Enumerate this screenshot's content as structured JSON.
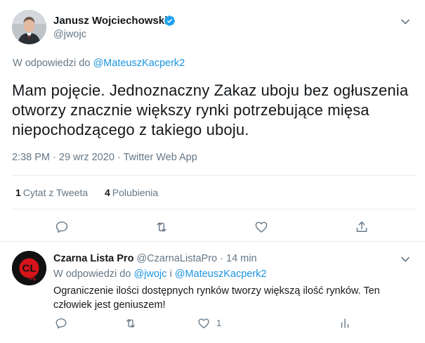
{
  "main_tweet": {
    "author_name": "Janusz Wojciechowski",
    "author_handle": "@jwojc",
    "reply_prefix": "W odpowiedzi do",
    "reply_to": "@MateuszKacperk2",
    "text": "Mam pojęcie. Jednoznaczny Zakaz uboju bez ogłuszenia otworzy znacznie większy rynki potrzebujące mięsa niepochodzącego z takiego uboju.",
    "meta": "2:38 PM · 29 wrz 2020 · Twitter Web App",
    "stats": {
      "quotes_count": "1",
      "quotes_label": "Cytat z Tweeta",
      "likes_count": "4",
      "likes_label": "Polubienia"
    },
    "icons": [
      "verified-badge-icon",
      "chevron-down-icon",
      "reply-icon",
      "retweet-icon",
      "like-icon",
      "share-icon"
    ],
    "colors": {
      "link": "#1b95e0",
      "verified": "#1da1f2",
      "secondary_text": "#657786"
    }
  },
  "reply_tweet": {
    "author_name": "Czarna Lista Pro",
    "author_handle": "@CzarnaListaPro",
    "separator": "·",
    "time": "14 min",
    "reply_prefix": "W odpowiedzi do",
    "reply_to_1": "@jwojc",
    "reply_conjunction": "i",
    "reply_to_2": "@MateuszKacperk2",
    "text": "Ograniczenie ilości dostępnych rynków tworzy większą ilość rynków. Ten człowiek jest geniuszem!",
    "like_count": "1",
    "avatar_logo_text": "CL",
    "avatar_logo_sub": "org",
    "icons": [
      "chevron-down-icon",
      "reply-icon",
      "retweet-icon",
      "like-icon",
      "analytics-icon"
    ]
  }
}
